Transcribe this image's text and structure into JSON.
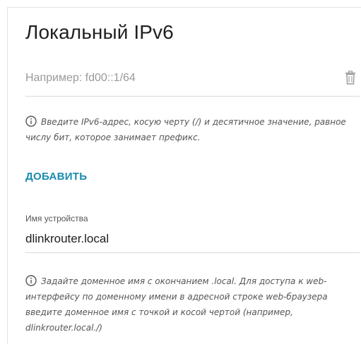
{
  "section": {
    "title": "Локальный IPv6"
  },
  "ipv6": {
    "value": "",
    "placeholder": "Например: fd00::1/64",
    "hint": "Введите IPv6-адрес, косую черту (/) и десятичное значение, равное числу бит, которое занимает префикс.",
    "add_label": "ДОБАВИТЬ"
  },
  "device": {
    "label": "Имя устройства",
    "value": "dlinkrouter.local",
    "hint": "Задайте доменное имя с окончанием .local. Для доступа к web-интерфейсу по доменному имени в адресной строке web-браузера введите доменное имя с точкой и косой чертой (например, dlinkrouter.local./)"
  },
  "icons": {
    "delete": "trash-icon",
    "info": "info-icon"
  },
  "colors": {
    "accent": "#1a8ab0",
    "hint_text": "#555555",
    "placeholder": "#9a9a9a",
    "border": "#d9d9d9"
  }
}
